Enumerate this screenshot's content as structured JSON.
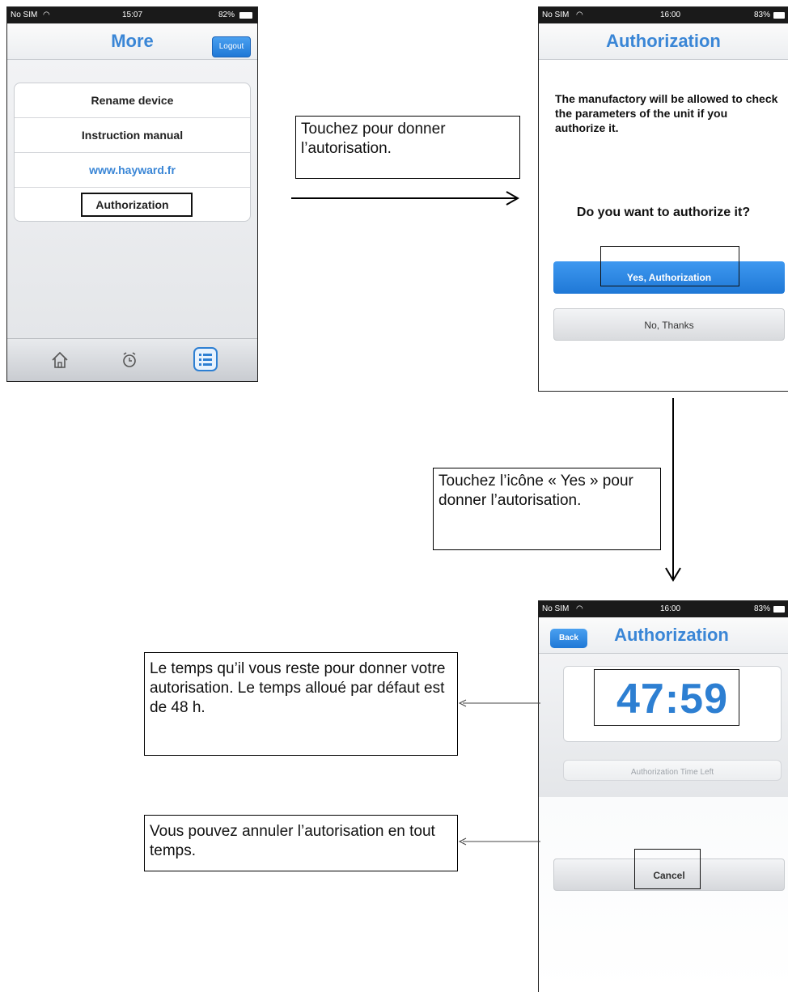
{
  "phone_more": {
    "status": {
      "carrier": "No SIM",
      "time": "15:07",
      "battery": "82%"
    },
    "title": "More",
    "logout_label": "Logout",
    "menu": [
      {
        "label": "Rename device"
      },
      {
        "label": "Instruction manual"
      },
      {
        "label": "www.hayward.fr"
      },
      {
        "label": "Authorization"
      }
    ],
    "tabs": [
      {
        "icon": "home-icon"
      },
      {
        "icon": "alarm-clock-icon"
      },
      {
        "icon": "list-icon"
      }
    ],
    "accent": "#3a86d6"
  },
  "phone_authorize": {
    "status": {
      "carrier": "No SIM",
      "time": "16:00",
      "battery": "83%"
    },
    "title": "Authorization",
    "message": "The manufactory will be allowed to check the parameters of the unit if you authorize it.",
    "question": "Do you want to authorize it?",
    "yes_label": "Yes, Authorization",
    "no_label": "No, Thanks"
  },
  "phone_timer": {
    "status": {
      "carrier": "No SIM",
      "time": "16:00",
      "battery": "83%"
    },
    "back_label": "Back",
    "title": "Authorization",
    "time_left": "47:59",
    "time_left_label": "Authorization Time Left",
    "cancel_label": "Cancel"
  },
  "callouts": {
    "tap_to_authorize": "Touchez pour donner l’autorisation.",
    "tap_yes": "Touchez l’icône « Yes » pour donner l’autorisation.",
    "time_remaining": "Le temps qu’il vous reste pour donner votre autorisation. Le temps alloué par défaut est de 48 h.",
    "cancel_anytime": "Vous pouvez annuler l’autorisation en tout temps."
  }
}
